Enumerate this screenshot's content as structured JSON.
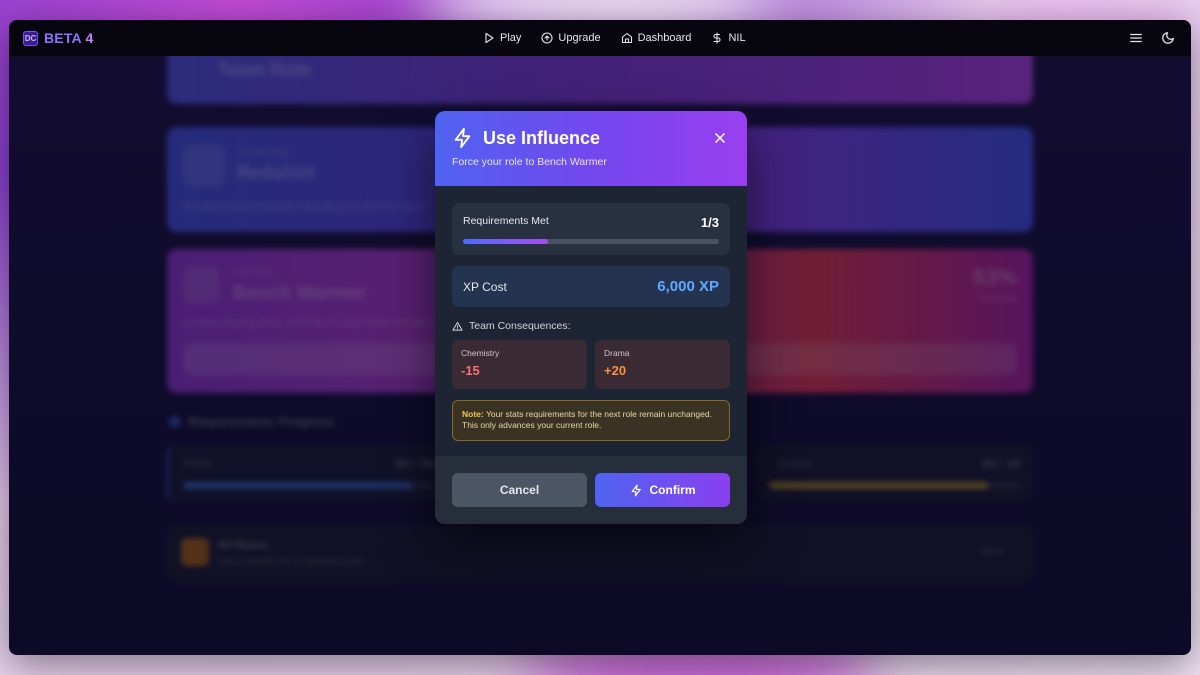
{
  "app": {
    "logo_text": "BETA",
    "version": "4",
    "logo_mark": "DC"
  },
  "nav": {
    "items": [
      {
        "label": "Play",
        "icon": "play-icon"
      },
      {
        "label": "Upgrade",
        "icon": "upgrade-icon"
      },
      {
        "label": "Dashboard",
        "icon": "home-icon"
      },
      {
        "label": "NIL",
        "icon": "dollar-icon"
      }
    ],
    "right_icons": [
      "menu-icon",
      "moon-icon"
    ]
  },
  "modal": {
    "title": "Use Influence",
    "subtitle": "Force your role to Bench Warmer",
    "requirements": {
      "label": "Requirements Met",
      "count": "1/3",
      "progress": 0.333
    },
    "xp": {
      "label": "XP Cost",
      "value": "6,000 XP"
    },
    "consequences": {
      "title": "Team Consequences:",
      "items": [
        {
          "label": "Chemistry",
          "value": "-15",
          "color": "#f87171"
        },
        {
          "label": "Drama",
          "value": "+20",
          "color": "#fb923c"
        }
      ]
    },
    "note": {
      "label": "Note:",
      "text": "Your stats requirements for the next role remain unchanged. This only advances your current role."
    },
    "buttons": {
      "cancel": "Cancel",
      "confirm": "Confirm"
    }
  },
  "background": {
    "team_role": "Team Role",
    "current_role": {
      "label": "Current Role",
      "title": "Redshirt",
      "desc": "Practice squad member focusing on development"
    },
    "next_role": {
      "label": "Next Role",
      "title": "Bench Warmer",
      "desc": "Limited playing time, working to earn more minutes",
      "percent": "53%",
      "percent_label": "Complete"
    },
    "requirements_title": "Requirements Progress",
    "stats": [
      {
        "label": "Points",
        "value": "82 / 90",
        "progress": 0.91,
        "color": "#3b82f6"
      },
      {
        "label": "Assists",
        "value": "26 / 30",
        "progress": 0.87,
        "color": "#eab308"
      }
    ],
    "all_roles": {
      "title": "All Roles",
      "desc": "View complete role progression path",
      "action": "Show"
    }
  }
}
